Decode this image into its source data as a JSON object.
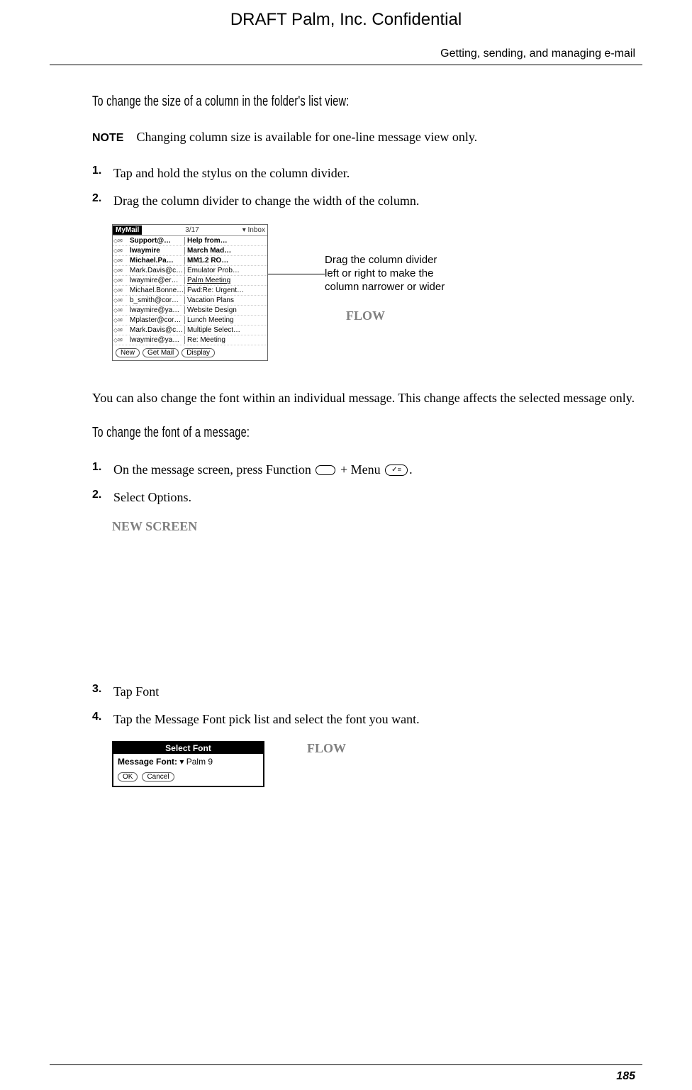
{
  "draft_header": "DRAFT   Palm, Inc. Confidential",
  "page_header": "Getting, sending, and managing e-mail",
  "section1": {
    "title": "To change the size of a column in the folder's list view:",
    "note_label": "NOTE",
    "note_text": "Changing column size is available for one-line message view only.",
    "steps": [
      "Tap and hold the stylus on the column divider.",
      "Drag the column divider to change the width of the column."
    ]
  },
  "device": {
    "app": "MyMail",
    "date": "3/17",
    "folder_prefix": "▾",
    "folder": "Inbox",
    "rows": [
      {
        "sender": "Support@…",
        "subject": "Help from…",
        "bold": true
      },
      {
        "sender": "lwaymire",
        "subject": "March Mad…",
        "bold": true
      },
      {
        "sender": "Michael.Pa…",
        "subject": "MM1.2 RO…",
        "bold": true
      },
      {
        "sender": "Mark.Davis@c…",
        "subject": "Emulator Prob…"
      },
      {
        "sender": "lwaymire@er…",
        "subject": "Palm Meeting",
        "underline": true
      },
      {
        "sender": "Michael.Bonne…",
        "subject": "Fwd:Re: Urgent…"
      },
      {
        "sender": "b_smith@cor…",
        "subject": "Vacation Plans"
      },
      {
        "sender": "lwaymire@ya…",
        "subject": "Website Design"
      },
      {
        "sender": "Mplaster@cor…",
        "subject": "Lunch Meeting"
      },
      {
        "sender": "Mark.Davis@c…",
        "subject": "Multiple Select…"
      },
      {
        "sender": "lwaymire@ya…",
        "subject": "Re: Meeting"
      }
    ],
    "buttons": [
      "New",
      "Get Mail",
      "Display"
    ]
  },
  "callout": {
    "text": "Drag the column divider left or right to make the column narrower or wider",
    "flow": "FLOW"
  },
  "para1": "You can also change the font within an individual message. This change affects the selected message only.",
  "section2": {
    "title": "To change the font of a message:",
    "step1_pre": "On the message screen, press Function ",
    "step1_mid": " + Menu ",
    "step1_post": ".",
    "step2": "Select Options.",
    "new_screen": "NEW SCREEN",
    "step3": "Tap Font",
    "step4": "Tap the Message Font pick list and select the font you want."
  },
  "dialog": {
    "title": "Select Font",
    "field_label": "Message Font:",
    "field_value": "Palm 9",
    "buttons": [
      "OK",
      "Cancel"
    ]
  },
  "flow2": "FLOW",
  "page_number": "185"
}
